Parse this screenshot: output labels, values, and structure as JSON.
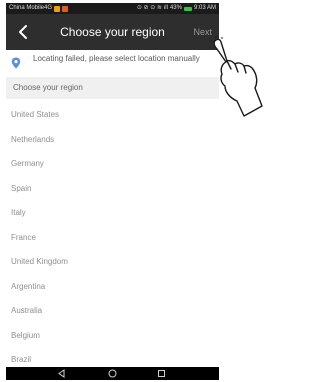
{
  "status_bar": {
    "carrier": "China Mobile4G",
    "indicators": "43%",
    "time": "9:03 AM",
    "colors": {
      "carrier_badge_1": "#f0a000",
      "carrier_badge_2": "#e85b1f",
      "battery": "#3cc23c"
    }
  },
  "header": {
    "back_icon": "chevron-left-icon",
    "title": "Choose your region",
    "next_label": "Next"
  },
  "notice": {
    "icon": "location-pin-icon",
    "text": "Locating failed, please select location manually",
    "icon_color": "#5b8fd8"
  },
  "region_search": {
    "placeholder": "Choose your region"
  },
  "regions": [
    "United States",
    "Netherlands",
    "Germany",
    "Spain",
    "Italy",
    "France",
    "United Kingdom",
    "Argentina",
    "Australia",
    "Belgium",
    "Brazil"
  ],
  "nav_bar": {
    "buttons": [
      "back-triangle-icon",
      "home-circle-icon",
      "recents-square-icon"
    ]
  }
}
